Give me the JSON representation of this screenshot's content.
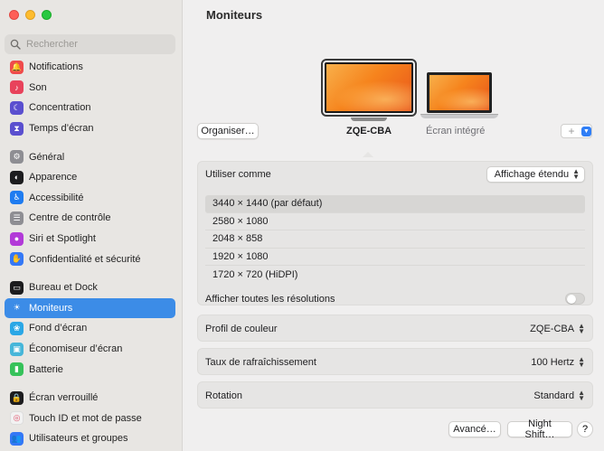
{
  "window": {
    "search_placeholder": "Rechercher",
    "title": "Moniteurs"
  },
  "sidebar": {
    "groups": [
      [
        {
          "label": "Notifications",
          "icon": "bell-icon",
          "color": "#ef4b4b"
        },
        {
          "label": "Son",
          "icon": "speaker-icon",
          "color": "#e8425b"
        },
        {
          "label": "Concentration",
          "icon": "moon-icon",
          "color": "#5a4fcf"
        },
        {
          "label": "Temps d’écran",
          "icon": "hourglass-icon",
          "color": "#5a4fcf"
        }
      ],
      [
        {
          "label": "Général",
          "icon": "gear-icon",
          "color": "#8e8e93"
        },
        {
          "label": "Apparence",
          "icon": "appearance-icon",
          "color": "#1c1c1e"
        },
        {
          "label": "Accessibilité",
          "icon": "accessibility-icon",
          "color": "#1f7cf0"
        },
        {
          "label": "Centre de contrôle",
          "icon": "control-center-icon",
          "color": "#8e8e93"
        },
        {
          "label": "Siri et Spotlight",
          "icon": "siri-icon",
          "color": "#b23ad8"
        },
        {
          "label": "Confidentialité et sécurité",
          "icon": "hand-icon",
          "color": "#3478f6"
        }
      ],
      [
        {
          "label": "Bureau et Dock",
          "icon": "dock-icon",
          "color": "#1c1c1e"
        },
        {
          "label": "Moniteurs",
          "icon": "sun-icon",
          "color": "#3c8ce7",
          "active": true
        },
        {
          "label": "Fond d’écran",
          "icon": "flower-icon",
          "color": "#2aa7e6"
        },
        {
          "label": "Économiseur d’écran",
          "icon": "screensaver-icon",
          "color": "#46b6d9"
        },
        {
          "label": "Batterie",
          "icon": "battery-icon",
          "color": "#36c25a"
        }
      ],
      [
        {
          "label": "Écran verrouillé",
          "icon": "lock-icon",
          "color": "#1c1c1e"
        },
        {
          "label": "Touch ID et mot de passe",
          "icon": "fingerprint-icon",
          "color": "#f2f2f2"
        },
        {
          "label": "Utilisateurs et groupes",
          "icon": "users-icon",
          "color": "#3478f6"
        }
      ]
    ]
  },
  "displays": {
    "organize_label": "Organiser…",
    "external_name": "ZQE-CBA",
    "internal_name": "Écran intégré",
    "add_symbol": "+"
  },
  "settings": {
    "use_as_label": "Utiliser comme",
    "use_as_value": "Affichage étendu",
    "resolutions": [
      {
        "label": "3440 × 1440 (par défaut)",
        "selected": true
      },
      {
        "label": "2580 × 1080"
      },
      {
        "label": "2048 × 858"
      },
      {
        "label": "1920 × 1080"
      },
      {
        "label": "1720 × 720 (HiDPI)"
      }
    ],
    "show_all_label": "Afficher toutes les résolutions",
    "show_all_on": false,
    "color_profile_label": "Profil de couleur",
    "color_profile_value": "ZQE-CBA",
    "refresh_label": "Taux de rafraîchissement",
    "refresh_value": "100 Hertz",
    "rotation_label": "Rotation",
    "rotation_value": "Standard"
  },
  "footer": {
    "advanced_label": "Avancé…",
    "night_shift_label": "Night Shift…",
    "help_label": "?"
  }
}
